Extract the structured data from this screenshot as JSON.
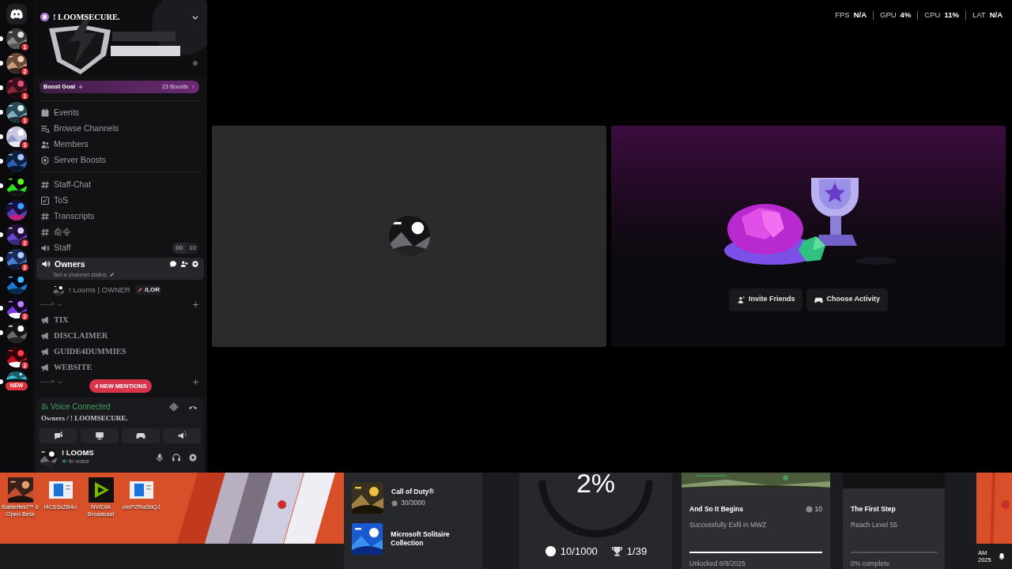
{
  "server_rail": {
    "servers": [
      {
        "kind": "home",
        "unread": false
      },
      {
        "kind": "picture",
        "badge": "1",
        "unread": true
      },
      {
        "kind": "picture",
        "badge": "2",
        "unread": true
      },
      {
        "kind": "picture",
        "badge": "1",
        "unread": true
      },
      {
        "kind": "picture",
        "badge": "1",
        "unread": true
      },
      {
        "kind": "picture",
        "badge": "3",
        "unread": true
      },
      {
        "kind": "picture",
        "unread": true
      },
      {
        "kind": "picture",
        "unread": true
      },
      {
        "kind": "picture",
        "unread": false
      },
      {
        "kind": "picture",
        "badge": "2",
        "unread": true
      },
      {
        "kind": "picture",
        "badge": "2",
        "unread": true
      },
      {
        "kind": "picture",
        "unread": false
      },
      {
        "kind": "picture",
        "badge": "2",
        "unread": true
      },
      {
        "kind": "picture",
        "unread": true
      },
      {
        "kind": "picture",
        "badge": "2",
        "unread": false
      },
      {
        "kind": "picture",
        "unread": true
      }
    ],
    "new_pill": "NEW"
  },
  "server": {
    "name": "! LOOMSECURE.",
    "boost_goal": {
      "label": "Boost Goal",
      "count": "23 Boosts"
    },
    "menu": [
      {
        "kind": "events",
        "label": "Events"
      },
      {
        "kind": "browse",
        "label": "Browse Channels"
      },
      {
        "kind": "members",
        "label": "Members"
      },
      {
        "kind": "boosts",
        "label": "Server Boosts"
      }
    ]
  },
  "channels": [
    {
      "kind": "text",
      "name": "Staff-Chat",
      "selected": false
    },
    {
      "kind": "rules",
      "name": "ToS",
      "selected": false
    },
    {
      "kind": "text",
      "name": "Transcripts",
      "selected": false
    },
    {
      "kind": "text",
      "name": "命令",
      "selected": false
    },
    {
      "kind": "voice",
      "name": "Staff",
      "selected": false,
      "user_count": "00",
      "user_limit": "10"
    },
    {
      "kind": "voice",
      "name": "Owners",
      "selected": true,
      "status": "Set a channel status"
    },
    {
      "kind": "member",
      "name": "! Looms | OWNER",
      "tag": "/LOR"
    },
    {
      "kind": "category",
      "name": "----->"
    },
    {
      "kind": "announcement",
      "name": "TIX",
      "selected": false
    },
    {
      "kind": "announcement",
      "name": "DISCLAIMER",
      "selected": false
    },
    {
      "kind": "announcement",
      "name": "GUIDE4DUMMIES",
      "selected": false
    },
    {
      "kind": "announcement",
      "name": "WEBSITE",
      "selected": false
    },
    {
      "kind": "category",
      "name": "----->"
    }
  ],
  "mentions_pill": "4 NEW MENTIONS",
  "voice_panel": {
    "status": "Voice Connected",
    "location": "Owners / ! LOOMSECURE."
  },
  "user_panel": {
    "name": "! LOOMS",
    "status": "In voice"
  },
  "overlay_stats": [
    {
      "label": "FPS",
      "value": "N/A"
    },
    {
      "label": "GPU",
      "value": "4%"
    },
    {
      "label": "CPU",
      "value": "11%"
    },
    {
      "label": "LAT",
      "value": "N/A"
    }
  ],
  "activity": {
    "buttons": [
      {
        "kind": "invite",
        "label": "Invite Friends"
      },
      {
        "kind": "activity",
        "label": "Choose Activity"
      }
    ]
  },
  "desktop_icons": [
    {
      "kind": "game",
      "label": "Battlefield™ 6 Open Beta"
    },
    {
      "kind": "file",
      "label": "l4C63xZB4o"
    },
    {
      "kind": "nvidia",
      "label": "NVIDIA Broadcast"
    },
    {
      "kind": "file",
      "label": "oIePZRaSbQJ"
    }
  ],
  "xbox": {
    "games": [
      {
        "title": "Call of Duty®",
        "score": "30/3000"
      },
      {
        "title": "Microsoft Solitaire Collection"
      }
    ],
    "progress": {
      "percent": "2%",
      "gamerscore": "10/1000",
      "trophies": "1/39"
    },
    "achievements": [
      {
        "title": "And So It Begins",
        "score": "10",
        "description": "Successfully Exfil in MWZ",
        "footer": "Unlocked 8/8/2025",
        "level": 1
      },
      {
        "kind": "plain",
        "title": "The First Step",
        "description": "Reach Level 55",
        "footer": "0% complete",
        "level": 0
      }
    ]
  },
  "clock": [
    "AM",
    "2025"
  ]
}
